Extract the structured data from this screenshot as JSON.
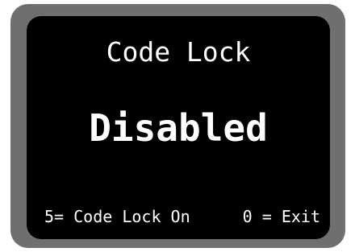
{
  "display": {
    "title": "Code Lock",
    "status": "Disabled",
    "soft_keys": {
      "left": "5= Code Lock On",
      "right": "0 = Exit"
    }
  },
  "colors": {
    "bezel": "#6f6f6f",
    "screen_background": "#000000",
    "text": "#ffffff"
  }
}
